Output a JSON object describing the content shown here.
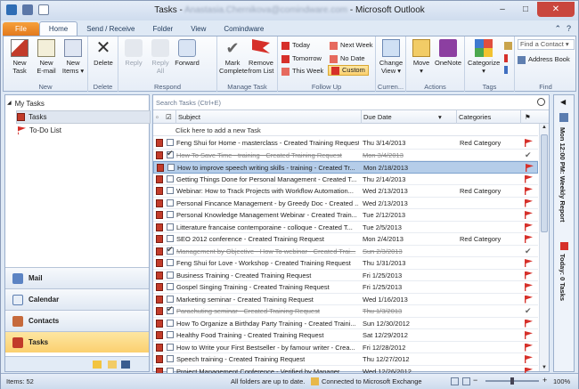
{
  "window": {
    "title_prefix": "Tasks - ",
    "account": "Anastasia.Chernikova@comindware.com",
    "title_suffix": " - Microsoft Outlook",
    "controls": [
      "–",
      "□",
      "✕"
    ]
  },
  "ribbon_tabs": [
    "File",
    "Home",
    "Send / Receive",
    "Folder",
    "View",
    "Comindware"
  ],
  "tab_help": [
    "⌃",
    "?"
  ],
  "ribbon": {
    "new": {
      "new_task": "New\nTask",
      "new_email": "New\nE-mail",
      "new_items": "New\nItems ▾",
      "label": "New"
    },
    "delete": {
      "delete": "Delete",
      "label": "Delete"
    },
    "respond": {
      "reply": "Reply",
      "reply_all": "Reply\nAll",
      "forward": "Forward",
      "label": "Respond"
    },
    "manage": {
      "mark_complete": "Mark\nComplete",
      "remove": "Remove\nfrom List",
      "label": "Manage Task"
    },
    "followup": {
      "today": "Today",
      "next_week": "Next Week",
      "tomorrow": "Tomorrow",
      "no_date": "No Date",
      "this_week": "This Week",
      "custom": "Custom",
      "label": "Follow Up"
    },
    "current": {
      "change_view": "Change\nView ▾",
      "label": "Curren..."
    },
    "actions": {
      "move": "Move\n▾",
      "onenote": "OneNote",
      "label": "Actions"
    },
    "tags": {
      "categorize": "Categorize\n▾",
      "label": "Tags"
    },
    "find": {
      "find_contact": "Find a Contact ▾",
      "address_book": "Address Book",
      "label": "Find"
    }
  },
  "nav": {
    "header": "My Tasks",
    "items": [
      "Tasks",
      "To-Do List"
    ],
    "buttons": [
      "Mail",
      "Calendar",
      "Contacts",
      "Tasks"
    ]
  },
  "content": {
    "search_placeholder": "Search Tasks (Ctrl+E)",
    "col_subject": "Subject",
    "col_due": "Due Date",
    "col_categories": "Categories",
    "add_new": "Click here to add a new Task",
    "tasks": [
      {
        "subject": "Feng Shui for Home - masterclass - Created Training Request",
        "due": "Thu 3/14/2013",
        "category": "Red Category",
        "done": false,
        "sel": false
      },
      {
        "subject": "How To Save Time - training - Created Training Request",
        "due": "Mon 3/4/2013",
        "category": "",
        "done": true,
        "sel": false
      },
      {
        "subject": "How to improve speech writing skills - training - Created Tr...",
        "due": "Mon 2/18/2013",
        "category": "",
        "done": false,
        "sel": true
      },
      {
        "subject": "Getting Things Done for Personal Management - Created T...",
        "due": "Thu 2/14/2013",
        "category": "",
        "done": false,
        "sel": false
      },
      {
        "subject": "Webinar: How to Track Projects with Workflow Automation...",
        "due": "Wed 2/13/2013",
        "category": "Red Category",
        "done": false,
        "sel": false
      },
      {
        "subject": "Personal Fincance Management - by Greedy Doc - Created ...",
        "due": "Wed 2/13/2013",
        "category": "",
        "done": false,
        "sel": false
      },
      {
        "subject": "Personal Knowledge Management Webinar - Created Train...",
        "due": "Tue 2/12/2013",
        "category": "",
        "done": false,
        "sel": false
      },
      {
        "subject": "Litterature francaise contemporaine - colloque - Created T...",
        "due": "Tue 2/5/2013",
        "category": "",
        "done": false,
        "sel": false
      },
      {
        "subject": "SEO 2012 conference - Created Training Request",
        "due": "Mon 2/4/2013",
        "category": "Red Category",
        "done": false,
        "sel": false
      },
      {
        "subject": "Management by Objective - How To webinar - Created Trai...",
        "due": "Sun 2/3/2013",
        "category": "",
        "done": true,
        "sel": false
      },
      {
        "subject": "Feng Shui for Love - Workshop - Created Training Request",
        "due": "Thu 1/31/2013",
        "category": "",
        "done": false,
        "sel": false
      },
      {
        "subject": "Business Training - Created Training Request",
        "due": "Fri 1/25/2013",
        "category": "",
        "done": false,
        "sel": false
      },
      {
        "subject": "Gospel Singing Training - Created Training Request",
        "due": "Fri 1/25/2013",
        "category": "",
        "done": false,
        "sel": false
      },
      {
        "subject": "Marketing seminar - Created Training Request",
        "due": "Wed 1/16/2013",
        "category": "",
        "done": false,
        "sel": false
      },
      {
        "subject": "Parachuting seminar - Created Training Request",
        "due": "Thu 1/3/2013",
        "category": "",
        "done": true,
        "sel": false
      },
      {
        "subject": "How To Organize a Birthday Party Training - Created Traini...",
        "due": "Sun 12/30/2012",
        "category": "",
        "done": false,
        "sel": false
      },
      {
        "subject": "Healthy Food Training - Created Training Request",
        "due": "Sat 12/29/2012",
        "category": "",
        "done": false,
        "sel": false
      },
      {
        "subject": "How to Write your First Bestseller - by famour writer - Crea...",
        "due": "Fri 12/28/2012",
        "category": "",
        "done": false,
        "sel": false
      },
      {
        "subject": "Speech training - Created Training Request",
        "due": "Thu 12/27/2012",
        "category": "",
        "done": false,
        "sel": false
      },
      {
        "subject": "Project Management Conference - Verified by Manager",
        "due": "Wed 12/26/2012",
        "category": "",
        "done": false,
        "sel": false
      }
    ]
  },
  "todobar": {
    "appointment": "Mon 12:00 PM: Weekly Report",
    "today": "Today: 0 Tasks"
  },
  "status": {
    "items": "Items: 52",
    "folders": "All folders are up to date.",
    "exchange": "Connected to Microsoft Exchange",
    "zoom": "100%",
    "zoom_minus": "−",
    "zoom_plus": "+"
  },
  "colors": {
    "red_flag": "#d6302a",
    "accent": "#fbd06f"
  }
}
